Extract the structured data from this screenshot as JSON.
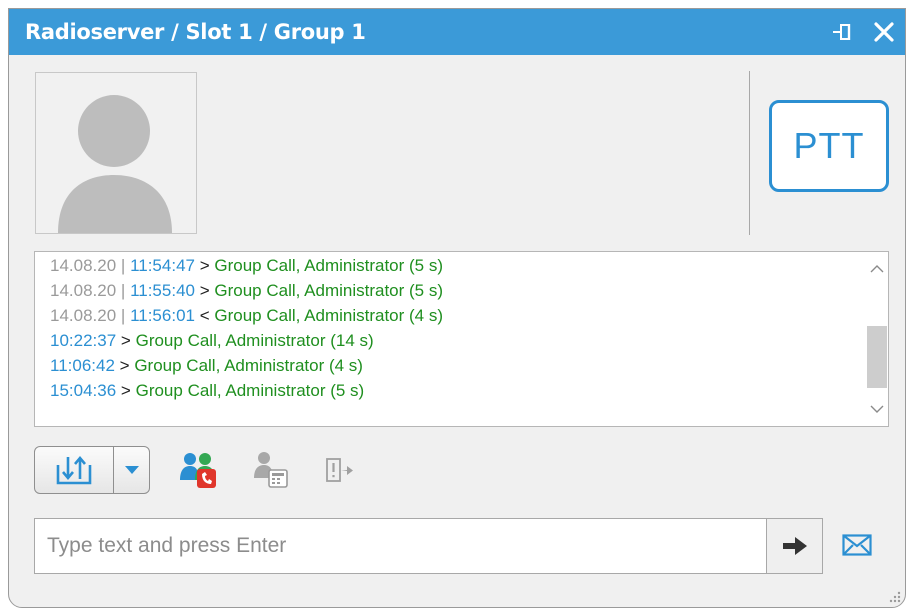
{
  "window": {
    "title": "Radioserver / Slot 1 / Group 1"
  },
  "ptt": {
    "label": "PTT"
  },
  "log": {
    "entries": [
      {
        "date": "14.08.20",
        "time": "11:54:47",
        "dir": ">",
        "text": "Group Call, Administrator (5 s)"
      },
      {
        "date": "14.08.20",
        "time": "11:55:40",
        "dir": ">",
        "text": "Group Call, Administrator (5 s)"
      },
      {
        "date": "14.08.20",
        "time": "11:56:01",
        "dir": "<",
        "text": "Group Call, Administrator (4 s)"
      },
      {
        "date": "",
        "time": "10:22:37",
        "dir": ">",
        "text": "Group Call, Administrator (14 s)"
      },
      {
        "date": "",
        "time": "11:06:42",
        "dir": ">",
        "text": "Group Call, Administrator (4 s)"
      },
      {
        "date": "",
        "time": "15:04:36",
        "dir": ">",
        "text": "Group Call, Administrator (5 s)"
      }
    ]
  },
  "message": {
    "placeholder": "Type text and press Enter"
  },
  "colors": {
    "accent": "#3b9ad8",
    "time": "#2b8fd2",
    "call": "#1f8f1f",
    "date": "#9a9a9a"
  },
  "icons": {
    "title_buttons": [
      "pin-icon",
      "close-icon"
    ],
    "toolbar": [
      "channel-select-icon",
      "dropdown-arrow-icon",
      "group-call-icon",
      "phone-call-icon",
      "exit-icon"
    ],
    "compose": [
      "send-arrow-icon",
      "envelope-icon"
    ]
  }
}
